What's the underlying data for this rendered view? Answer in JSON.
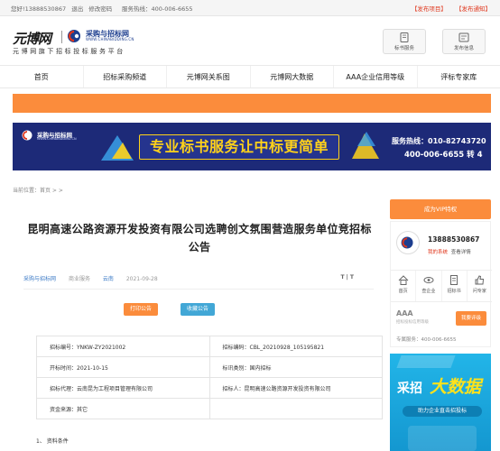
{
  "topbar": {
    "welcome": "您好!13888530867",
    "logout": "退出",
    "change_password": "修改密码",
    "hotline": "服务热线：400-006-6655",
    "publish_project": "【发布项目】",
    "publish_notice": "【发布通知】"
  },
  "header": {
    "logo_yuan": "元博网",
    "logo_cn": "采购与招标网",
    "logo_en": "WWW.CHINABIDDING.CN",
    "slogan": "元博网旗下招标投标服务平台",
    "btn_tender": "标书服务",
    "btn_info": "发布信息"
  },
  "nav": {
    "items": [
      "首页",
      "招标采购频道",
      "元博网关系图",
      "元博网大数据",
      "AAA企业信用等级",
      "评标专家库"
    ]
  },
  "banner": {
    "logo_cn": "采购与招标网",
    "logo_en": "WWW.CHINABIDDING.CN",
    "slogan": "专业标书服务让中标更简单",
    "phone_line1": "服务热线：010-82743720",
    "phone_line2": "400-006-6655 转 4"
  },
  "breadcrumb": "当前位置：首页 > >",
  "article": {
    "title": "昆明高速公路资源开发投资有限公司选聘创文氛围营造服务单位竞招标公告",
    "source": "采购与招标网",
    "category": "商业服务",
    "region": "云南",
    "date": "2021-09-28",
    "font_toggle": "T | T",
    "print_btn": "打印公告",
    "fav_btn": "收藏公告",
    "table": [
      [
        "招标编号：YNKW-ZY2021002",
        "招标编码：CBL_20210928_105195821"
      ],
      [
        "开标时间：2021-10-15",
        "标讯类别：国内招标"
      ],
      [
        "招标代理：云南昆为工程项目管理有限公司",
        "招标人：昆明高速公路资源开发投资有限公司"
      ],
      [
        "资金来源：其它",
        ""
      ]
    ],
    "section_1": "1、 资料条件"
  },
  "sidebar": {
    "vip_label": "成为VIP特权",
    "phone": "13888530867",
    "my_site": "我的系统",
    "view_detail": "查看详情",
    "icons": [
      {
        "name": "home",
        "label": "首页"
      },
      {
        "name": "view",
        "label": "查企业"
      },
      {
        "name": "tender",
        "label": "招标书"
      },
      {
        "name": "like",
        "label": "问专家"
      }
    ],
    "aaa": "AAA",
    "aaa_sub": "招标投标信用等级",
    "rate_btn": "我要评级",
    "hotline": "专属服务：400-006-6655"
  },
  "ad": {
    "word1": "采招",
    "word2": "大数据",
    "tagline": "助力企业直击招投标"
  },
  "colors": {
    "orange": "#fb8c3c",
    "banner_blue": "#1d2a78",
    "yellow": "#ffd21a",
    "red": "#e0361c",
    "link_blue": "#3b7ac6"
  }
}
